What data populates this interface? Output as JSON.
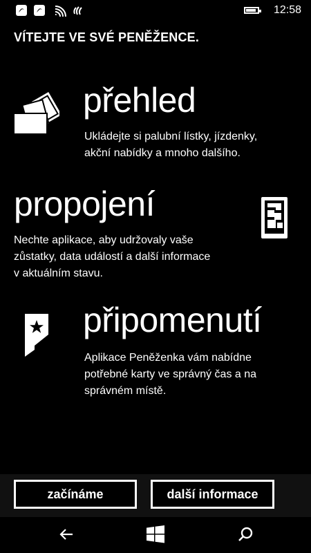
{
  "status_bar": {
    "time": "12:58",
    "battery_level": 0.85,
    "icons": [
      "notification-icon",
      "notification-icon",
      "wifi-icon",
      "nfc-icon",
      "battery-icon"
    ]
  },
  "page_title": "VÍTEJTE VE SVÉ PENĚŽENCE.",
  "sections": [
    {
      "title": "přehled",
      "description_lines": [
        "Ukládejte si palubní lístky, jízdenky,",
        "akční nabídky a mnoho dalšího."
      ],
      "icon": "cards-icon"
    },
    {
      "title": "propojení",
      "description_lines": [
        "Nechte aplikace, aby udržovaly vaše",
        "zůstatky, data událostí a další informace",
        "v aktuálním stavu."
      ],
      "icon": "phone-tiles-icon"
    },
    {
      "title": "připomenutí",
      "description_lines": [
        "Aplikace Peněženka vám nabídne",
        "potřebné karty ve správný čas a na",
        "správném místě."
      ],
      "icon": "star-tag-icon"
    }
  ],
  "buttons": {
    "start": "začínáme",
    "more_info": "další informace"
  },
  "nav_bar": {
    "icons": [
      "back-icon",
      "windows-icon",
      "search-icon"
    ]
  },
  "colors": {
    "background": "#000000",
    "foreground": "#ffffff",
    "app_bar": "#111111"
  }
}
